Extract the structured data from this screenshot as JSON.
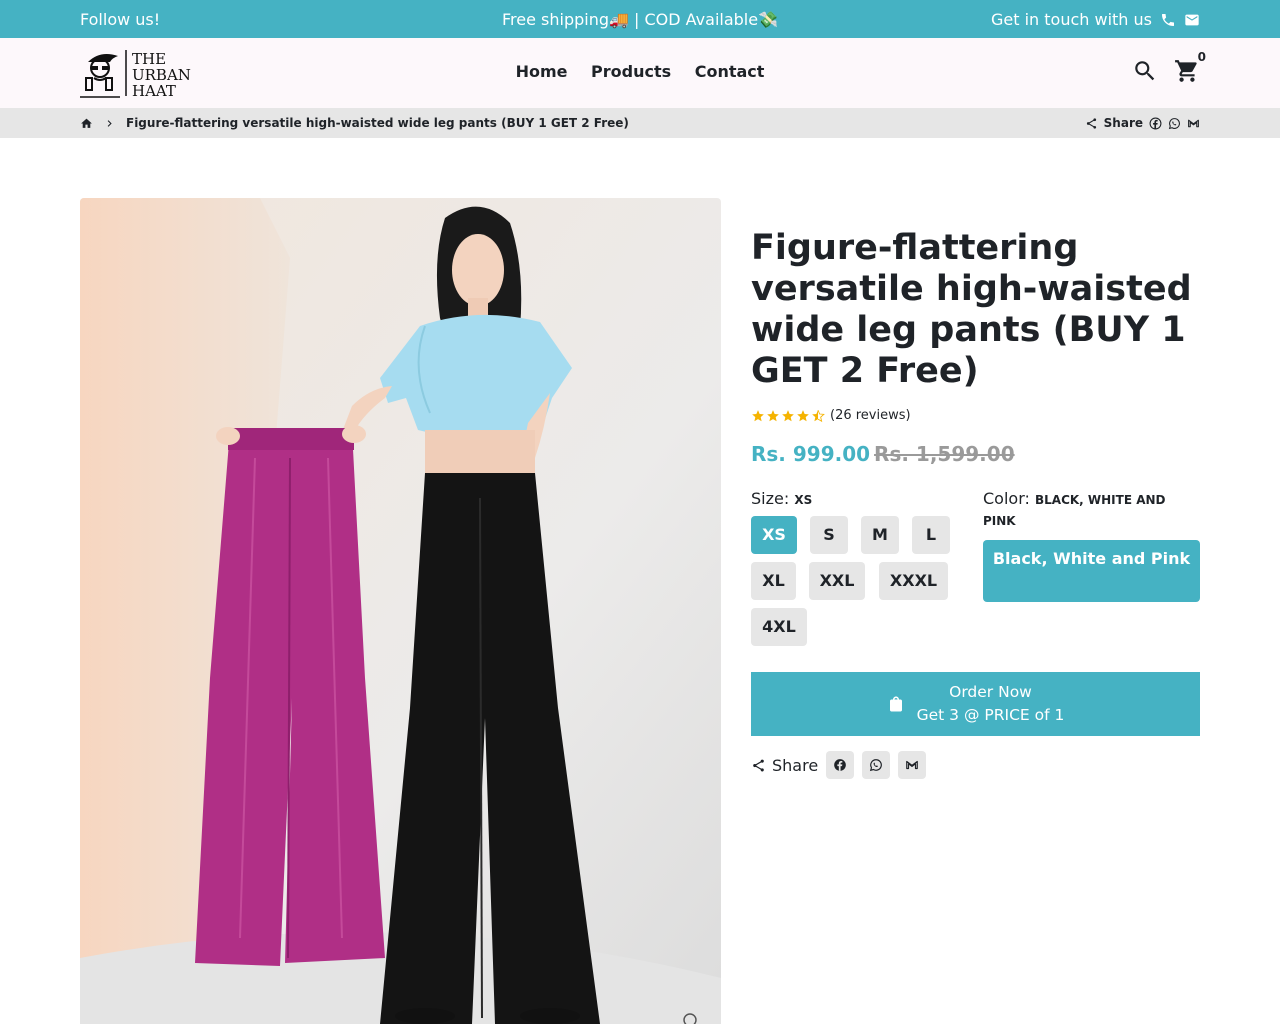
{
  "topbar": {
    "follow": "Follow us!",
    "announcement": "Free shipping🚚 | COD Available💸",
    "contact": "Get in touch with us",
    "icons": [
      "phone-icon",
      "mail-icon"
    ]
  },
  "header": {
    "logo_text": [
      "THE",
      "URBAN",
      "HAAT"
    ],
    "nav": [
      "Home",
      "Products",
      "Contact"
    ],
    "cart_count": "0",
    "icons": [
      "search-icon",
      "cart-icon"
    ]
  },
  "breadcrumb": {
    "current": "Figure-flattering versatile high-waisted wide leg pants (BUY 1 GET 2 Free)",
    "share_label": "Share"
  },
  "product": {
    "title": "Figure-flattering versatile high-waisted wide leg pants (BUY 1 GET 2 Free)",
    "rating": 4.5,
    "reviews": "(26 reviews)",
    "price": "Rs. 999.00",
    "compare_price": "Rs. 1,599.00",
    "size_label": "Size:",
    "size_selected": "XS",
    "sizes": [
      "XS",
      "S",
      "M",
      "L",
      "XL",
      "XXL",
      "XXXL",
      "4XL"
    ],
    "color_label": "Color:",
    "color_selected": "BLACK, WHITE AND PINK",
    "color_option": "Black, White and Pink",
    "order_line1": "Order Now",
    "order_line2": "Get 3 @ PRICE of 1",
    "share_label": "Share"
  },
  "colors": {
    "accent": "#45b2c3",
    "header_bg": "#fdf8fb",
    "chip_bg": "#e6e6e6",
    "star": "#f5b301"
  }
}
